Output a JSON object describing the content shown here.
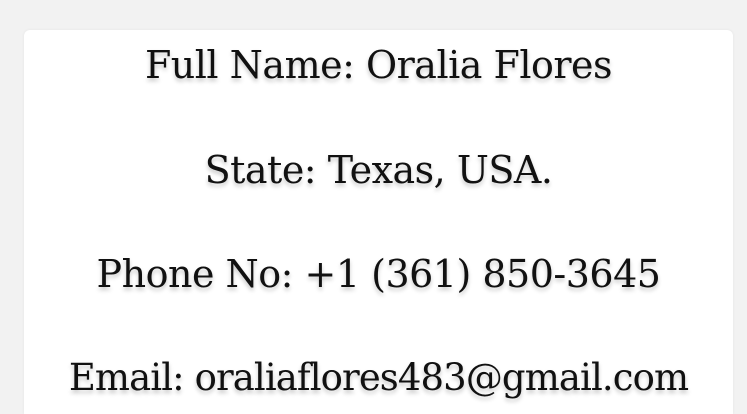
{
  "contact": {
    "full_name": "Full Name: Oralia Flores",
    "state": "State: Texas, USA.",
    "phone": "Phone No: +1 (361) 850-3645",
    "email": "Email: oraliaflores483@gmail.com"
  },
  "colors": {
    "background": "#f2f2f2",
    "card": "#ffffff",
    "text": "#111111"
  }
}
